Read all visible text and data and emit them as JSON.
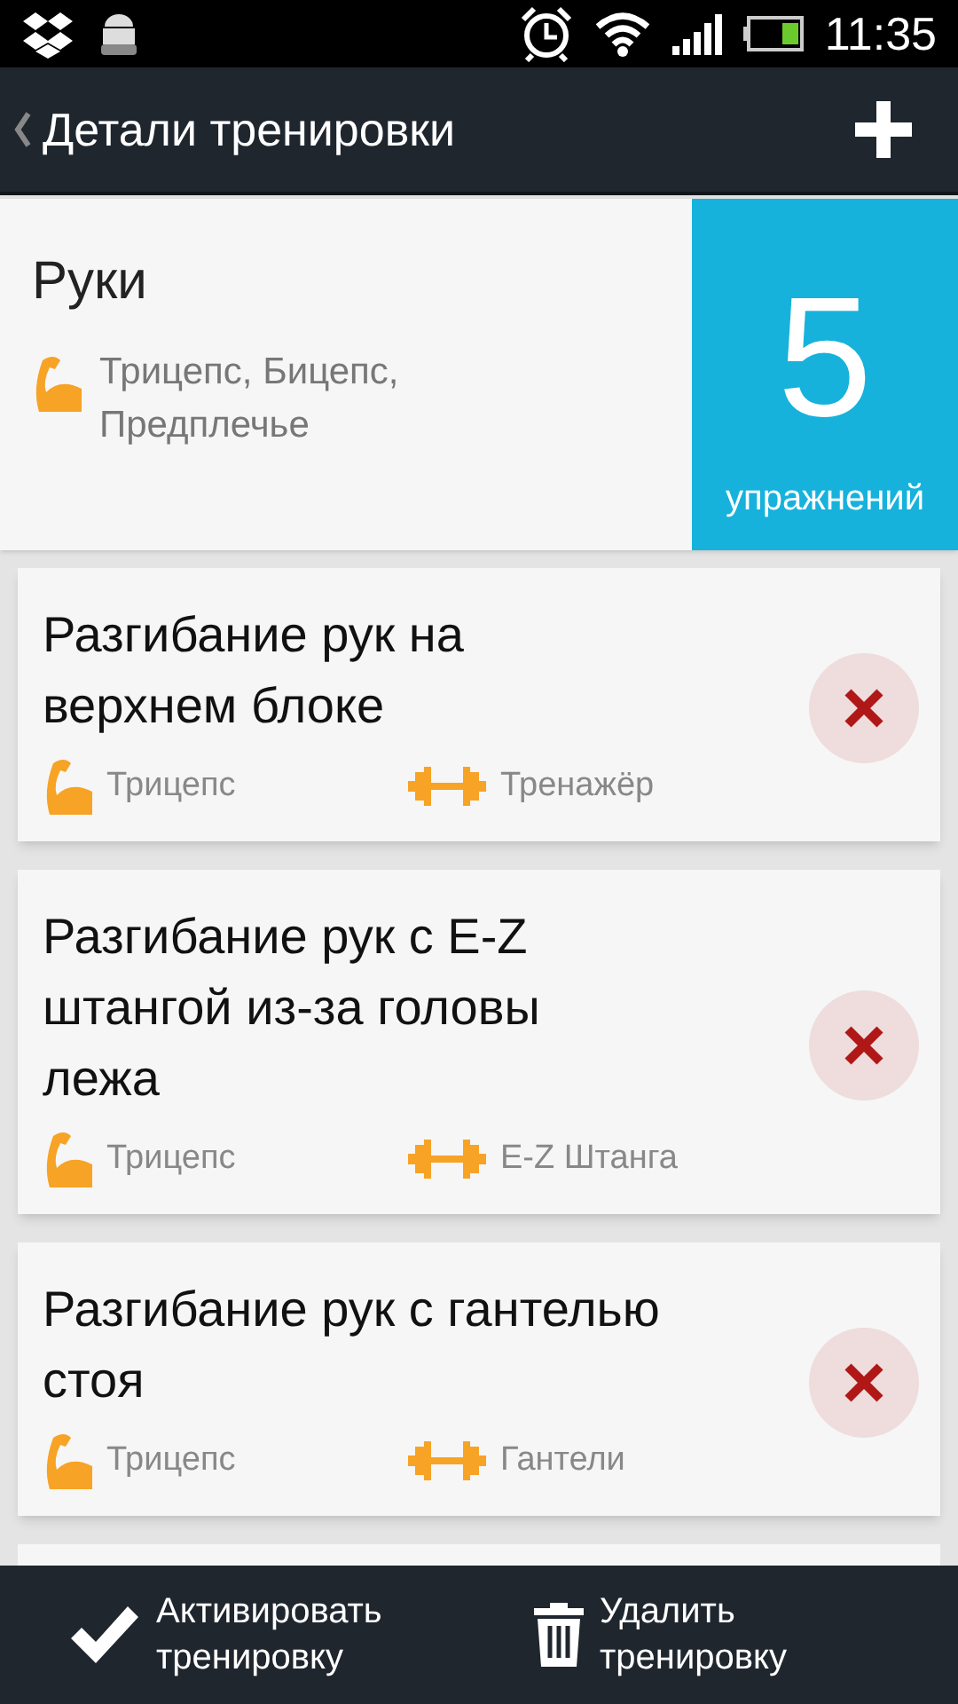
{
  "status_bar": {
    "time": "11:35"
  },
  "action_bar": {
    "title": "Детали тренировки"
  },
  "workout": {
    "name": "Руки",
    "muscles": "Трицепс, Бицепс, Предплечье",
    "count": "5",
    "count_label": "упражнений"
  },
  "exercises": [
    {
      "name": "Разгибание рук на верхнем блоке",
      "muscle": "Трицепс",
      "equipment": "Тренажёр"
    },
    {
      "name": "Разгибание рук с E-Z штангой из-за головы лежа",
      "muscle": "Трицепс",
      "equipment": "E-Z Штанга"
    },
    {
      "name": "Разгибание рук с гантелью стоя",
      "muscle": "Трицепс",
      "equipment": "Гантели"
    }
  ],
  "bottom_bar": {
    "activate": "Активировать тренировку",
    "delete": "Удалить тренировку"
  }
}
